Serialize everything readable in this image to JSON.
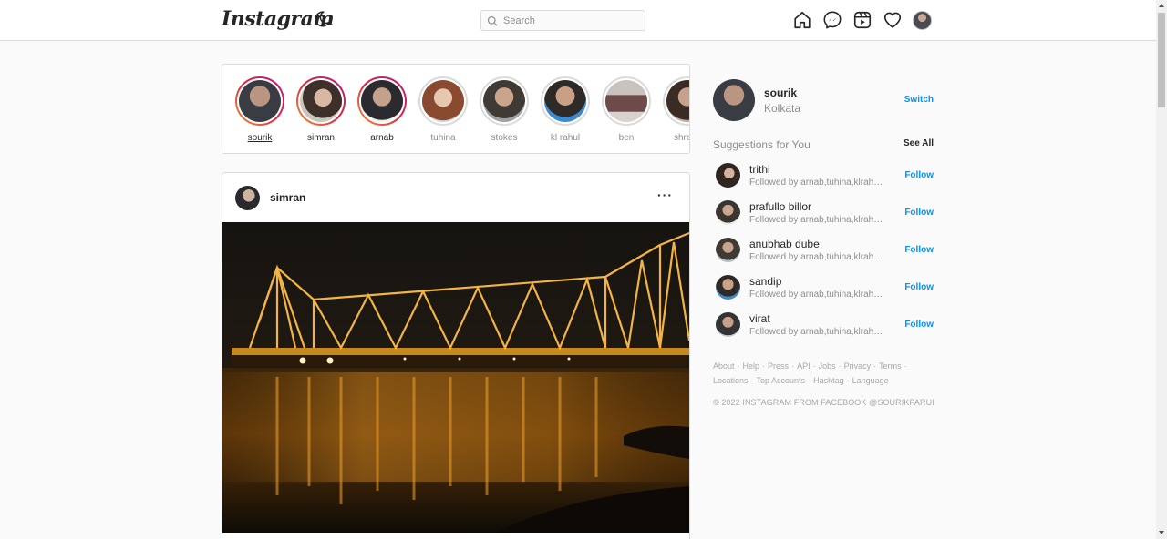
{
  "header": {
    "logo": "Instagram",
    "search_placeholder": "Search",
    "icons": [
      "home-icon",
      "messenger-icon",
      "reels-icon",
      "heart-icon",
      "profile-avatar"
    ]
  },
  "stories": [
    {
      "name": "sourik",
      "seen": false,
      "underlined": true
    },
    {
      "name": "simran",
      "seen": false
    },
    {
      "name": "arnab",
      "seen": false
    },
    {
      "name": "tuhina",
      "seen": true
    },
    {
      "name": "stokes",
      "seen": true
    },
    {
      "name": "kl rahul",
      "seen": true
    },
    {
      "name": "ben",
      "seen": true
    },
    {
      "name": "shreya",
      "seen": true
    }
  ],
  "post": {
    "username": "simran",
    "more_label": "···",
    "image": "night-bridge-photo"
  },
  "profile": {
    "username": "sourik",
    "location": "Kolkata",
    "switch_label": "Switch"
  },
  "suggestions": {
    "title": "Suggestions for You",
    "see_all": "See All",
    "follow_label": "Follow",
    "items": [
      {
        "name": "trithi",
        "sub": "Followed by arnab,tuhina,klrahul..."
      },
      {
        "name": "prafullo billor",
        "sub": "Followed by arnab,tuhina,klrahul..."
      },
      {
        "name": "anubhab dube",
        "sub": "Followed by arnab,tuhina,klrahul..."
      },
      {
        "name": "sandip",
        "sub": "Followed by arnab,tuhina,klrahul..."
      },
      {
        "name": "virat",
        "sub": "Followed by arnab,tuhina,klrahul..."
      }
    ]
  },
  "footer": {
    "links_row1": [
      "About",
      "Help",
      "Press",
      "API",
      "Jobs",
      "Privacy",
      "Terms"
    ],
    "links_row2": [
      "Locations",
      "Top Accounts",
      "Hashtag",
      "Language"
    ],
    "copyright": "© 2022 INSTAGRAM FROM FACEBOOK @SOURIKPARUI"
  },
  "colors": {
    "accent": "#0095f6",
    "border": "#dbdbdb",
    "muted": "#8e8e8e"
  }
}
